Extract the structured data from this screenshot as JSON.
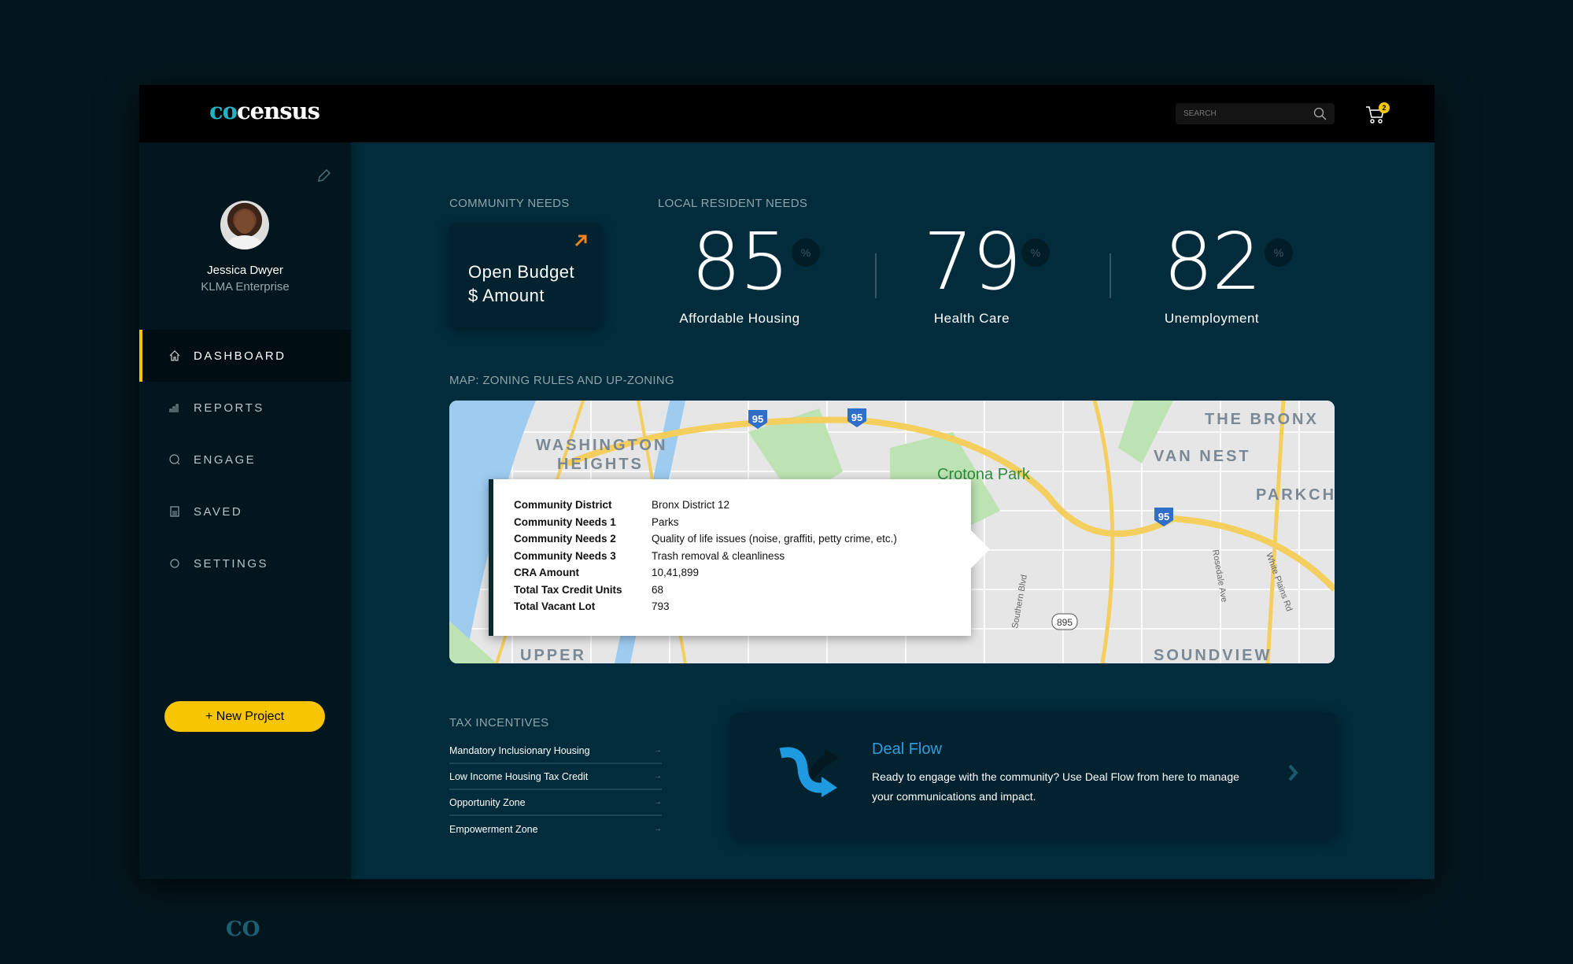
{
  "header": {
    "logo_prefix": "co",
    "logo_suffix": "census",
    "search_placeholder": "SEARCH",
    "cart_count": "2"
  },
  "user": {
    "name": "Jessica Dwyer",
    "company": "KLMA Enterprise"
  },
  "sidebar": {
    "items": [
      {
        "label": "DASHBOARD",
        "icon": "home-icon",
        "active": true
      },
      {
        "label": "REPORTS",
        "icon": "bar-chart-icon"
      },
      {
        "label": "ENGAGE",
        "icon": "chat-search-icon"
      },
      {
        "label": "SAVED",
        "icon": "save-icon"
      },
      {
        "label": "SETTINGS",
        "icon": "circle-icon"
      }
    ],
    "new_project": "+ New Project",
    "footer_logo": "CO"
  },
  "community_needs": {
    "title": "COMMUNITY NEEDS",
    "card": {
      "line1": "Open Budget",
      "line2": "$ Amount"
    }
  },
  "local_needs": {
    "title": "LOCAL RESIDENT NEEDS",
    "stats": [
      {
        "value": "85",
        "unit": "%",
        "label": "Affordable Housing"
      },
      {
        "value": "79",
        "unit": "%",
        "label": "Health Care"
      },
      {
        "value": "82",
        "unit": "%",
        "label": "Unemployment"
      }
    ]
  },
  "map": {
    "title": "MAP: ZONING RULES AND UP-ZONING",
    "labels": [
      "WASHINGTON",
      "HEIGHTS",
      "Crotona Park",
      "THE BRONX",
      "VAN NEST",
      "PARKCH",
      "UPPER",
      "SOUNDVIEW",
      "Southern Blvd",
      "Rosedale Ave",
      "White Plains Rd",
      "95",
      "95",
      "95",
      "895"
    ],
    "tooltip": [
      {
        "k": "Community District",
        "v": "Bronx District 12"
      },
      {
        "k": "Community Needs 1",
        "v": "Parks"
      },
      {
        "k": "Community Needs 2",
        "v": "Quality of life issues (noise, graffiti, petty crime, etc.)"
      },
      {
        "k": "Community Needs 3",
        "v": "Trash removal & cleanliness"
      },
      {
        "k": "CRA Amount",
        "v": "10,41,899"
      },
      {
        "k": "Total Tax Credit Units",
        "v": "68"
      },
      {
        "k": "Total Vacant Lot",
        "v": "793"
      }
    ]
  },
  "tax_incentives": {
    "title": "TAX INCENTIVES",
    "items": [
      "Mandatory Inclusionary Housing",
      "Low Income Housing Tax Credit",
      "Opportunity Zone",
      "Empowerment Zone"
    ]
  },
  "deal_flow": {
    "title": "Deal Flow",
    "description": "Ready to engage with the community? Use Deal Flow from here to manage your communications and impact."
  },
  "colors": {
    "accent": "#f7c600",
    "brand": "#1fb3c4",
    "link": "#2f9fe0",
    "arrow": "#f58220"
  }
}
